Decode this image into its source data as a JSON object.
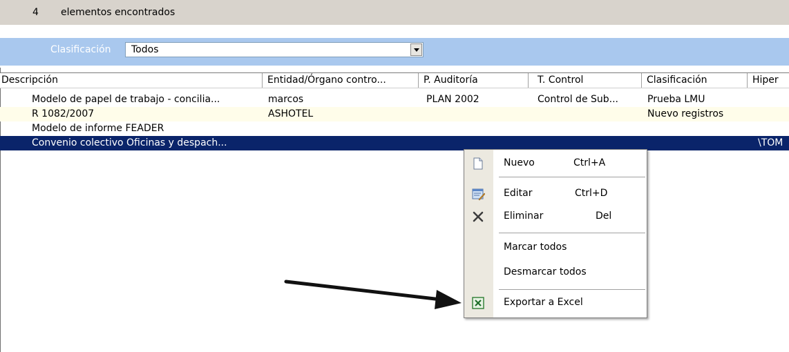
{
  "status": {
    "count": "4",
    "text": "elementos encontrados"
  },
  "filter": {
    "label": "Clasificación",
    "value": "Todos"
  },
  "grid": {
    "columns": [
      "Descripción",
      "Entidad/Órgano contro...",
      "P. Auditoría",
      "T. Control",
      "Clasificación",
      "Hiper"
    ],
    "rows": [
      {
        "descripcion": "Modelo de papel de trabajo - concilia...",
        "entidad": "marcos",
        "auditoria": "PLAN 2002",
        "control": "Control de Sub...",
        "clasificacion": "Prueba LMU",
        "hiper": ""
      },
      {
        "descripcion": "R 1082/2007",
        "entidad": "ASHOTEL",
        "auditoria": "",
        "control": "",
        "clasificacion": "Nuevo registros",
        "hiper": ""
      },
      {
        "descripcion": "Modelo de informe FEADER",
        "entidad": "",
        "auditoria": "",
        "control": "",
        "clasificacion": "",
        "hiper": ""
      },
      {
        "descripcion": "Convenio colectivo Oficinas y despach...",
        "entidad": "",
        "auditoria": "",
        "control": "",
        "clasificacion": "",
        "hiper": "\\TOM"
      }
    ],
    "selected_row": 3
  },
  "context_menu": {
    "items": [
      {
        "label": "Nuevo",
        "shortcut": "Ctrl+A",
        "icon": "new-document-icon"
      },
      {
        "label": "Editar",
        "shortcut": "Ctrl+D",
        "icon": "edit-icon"
      },
      {
        "label": "Eliminar",
        "shortcut": "Del",
        "icon": "delete-icon"
      },
      {
        "label": "Marcar todos",
        "shortcut": "",
        "icon": ""
      },
      {
        "label": "Desmarcar todos",
        "shortcut": "",
        "icon": ""
      },
      {
        "label": "Exportar a Excel",
        "shortcut": "",
        "icon": "excel-icon"
      }
    ]
  },
  "colors": {
    "header_bar": "#d8d3cc",
    "filter_bar": "#a9c8ee",
    "selection": "#0a246a",
    "row_alt": "#fffdea",
    "menu_gutter": "#ece9e0"
  }
}
